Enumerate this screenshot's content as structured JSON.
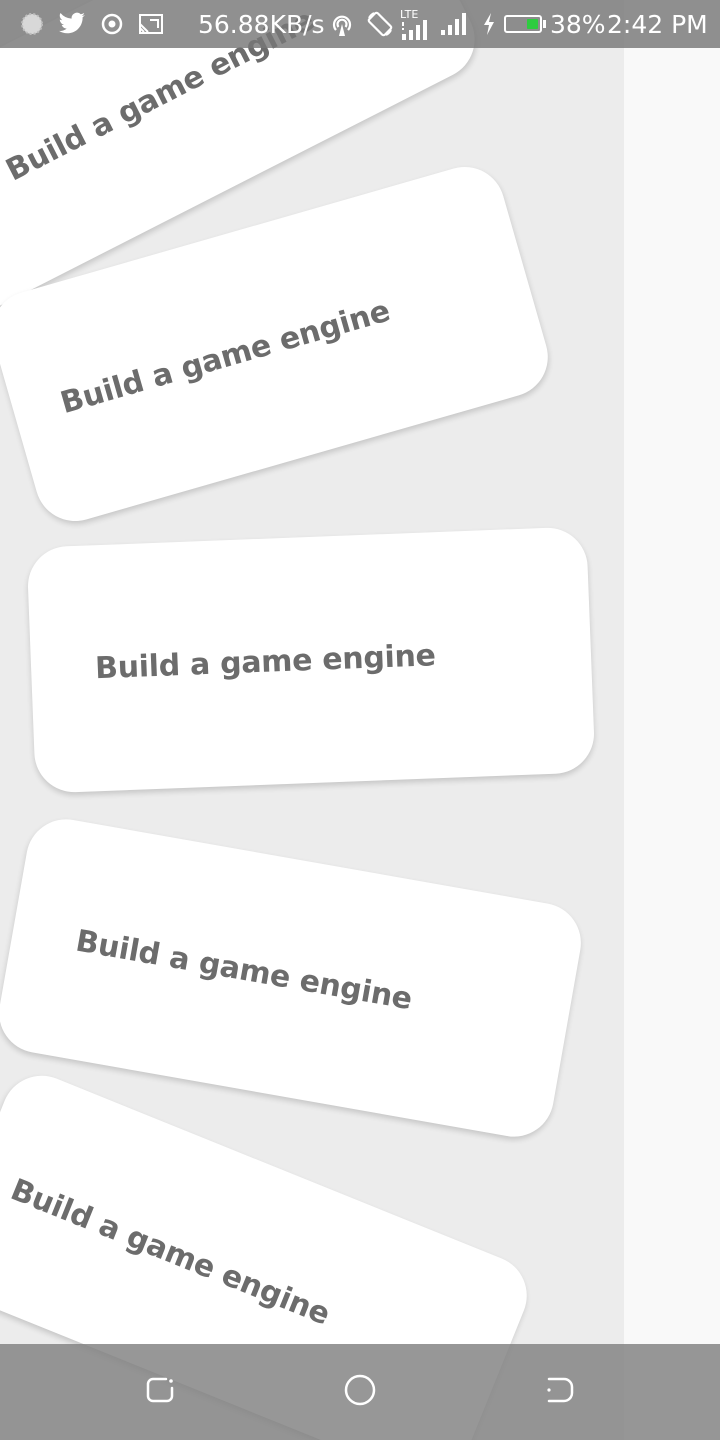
{
  "status_bar": {
    "network_speed": "56.88KB/s",
    "lte_label": "LTE",
    "battery_percent": "38%",
    "time": "2:42 PM",
    "battery_level": 0.38,
    "battery_fill_color": "#2ecc40",
    "icons": [
      "notification-dot-icon",
      "twitter-icon",
      "target-icon",
      "cast-icon",
      "hotspot-icon",
      "screen-rotation-icon",
      "lte-signal-icon",
      "signal-icon",
      "charging-icon",
      "battery-icon"
    ]
  },
  "cards": [
    {
      "label": "Build a game engine"
    },
    {
      "label": "Build a game engine"
    },
    {
      "label": "Build a game engine"
    },
    {
      "label": "Build a game engine"
    },
    {
      "label": "Build a game engine"
    }
  ],
  "nav_bar": {
    "icons": [
      "recent-apps-icon",
      "home-icon",
      "back-icon"
    ]
  },
  "colors": {
    "panel_background": "#ececec",
    "card_background": "#ffffff",
    "card_text": "#6c6c6c",
    "status_bar": "#787878",
    "nav_bar": "#808080"
  }
}
